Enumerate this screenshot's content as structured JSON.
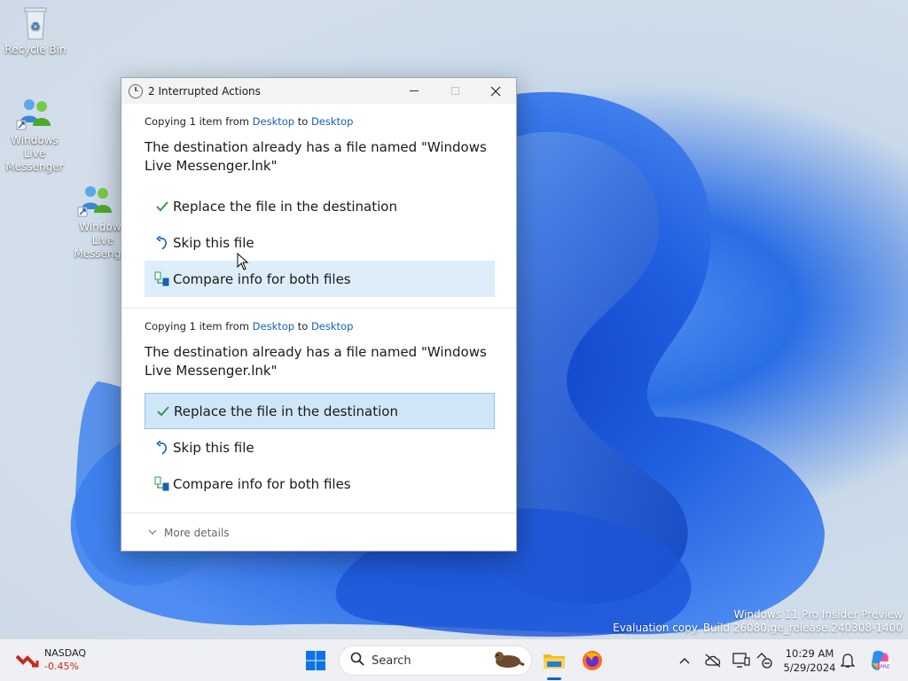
{
  "desktop": {
    "icons": [
      {
        "label": "Recycle Bin"
      },
      {
        "label": "Windows Live Messenger"
      },
      {
        "label": "Windows Live Messenger"
      }
    ],
    "watermark": {
      "line1": "Windows 11 Pro Insider Preview",
      "line2": "Evaluation copy. Build 26080.ge_release.240308-1400"
    }
  },
  "dialog": {
    "title": "2 Interrupted Actions",
    "conflicts": [
      {
        "copy_prefix": "Copying 1 item from",
        "from": "Desktop",
        "to_word": "to",
        "to": "Desktop",
        "message": "The destination already has a file named \"Windows Live Messenger.lnk\"",
        "options": {
          "replace": "Replace the file in the destination",
          "skip": "Skip this file",
          "compare": "Compare info for both files"
        }
      },
      {
        "copy_prefix": "Copying 1 item from",
        "from": "Desktop",
        "to_word": "to",
        "to": "Desktop",
        "message": "The destination already has a file named \"Windows Live Messenger.lnk\"",
        "options": {
          "replace": "Replace the file in the destination",
          "skip": "Skip this file",
          "compare": "Compare info for both files"
        }
      }
    ],
    "more_details": "More details"
  },
  "taskbar": {
    "widget": {
      "name": "NASDAQ",
      "change": "-0.45%"
    },
    "search_placeholder": "Search",
    "time": "10:29 AM",
    "date": "5/29/2024"
  },
  "colors": {
    "accent": "#0a64d6",
    "link": "#1a5fb4",
    "check": "#2e9e48",
    "negative": "#c42b1c"
  }
}
